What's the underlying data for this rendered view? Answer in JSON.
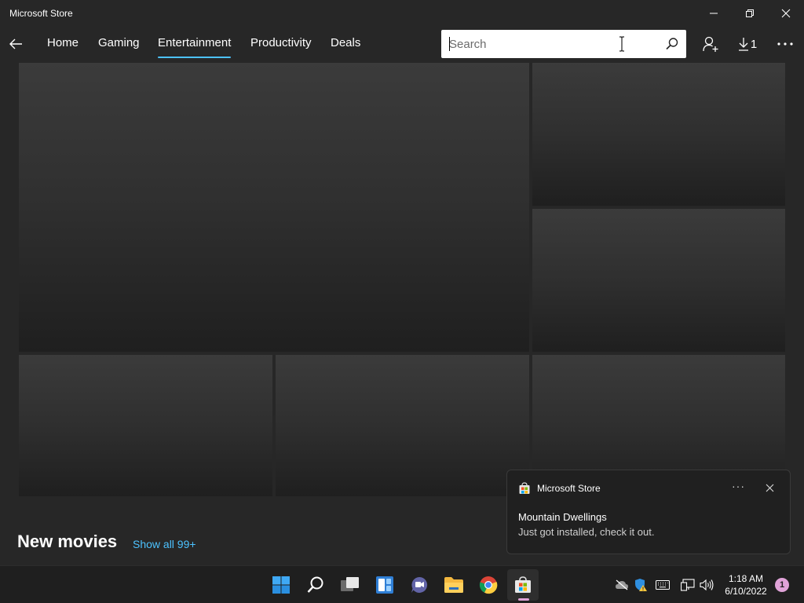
{
  "window": {
    "title": "Microsoft Store"
  },
  "nav": {
    "tabs": [
      {
        "label": "Home"
      },
      {
        "label": "Gaming"
      },
      {
        "label": "Entertainment",
        "active": true
      },
      {
        "label": "Productivity"
      },
      {
        "label": "Deals"
      }
    ],
    "search_placeholder": "Search",
    "downloads_count": "1"
  },
  "section": {
    "title": "New movies",
    "show_all": "Show all 99+"
  },
  "toast": {
    "app_name": "Microsoft Store",
    "more": "···",
    "title": "Mountain Dwellings",
    "body": "Just got installed, check it out."
  },
  "taskbar": {
    "time": "1:18 AM",
    "date": "6/10/2022",
    "notification_count": "1"
  },
  "colors": {
    "accent": "#4cc2ff",
    "background": "#272727",
    "taskbar": "#1f1f1f"
  }
}
